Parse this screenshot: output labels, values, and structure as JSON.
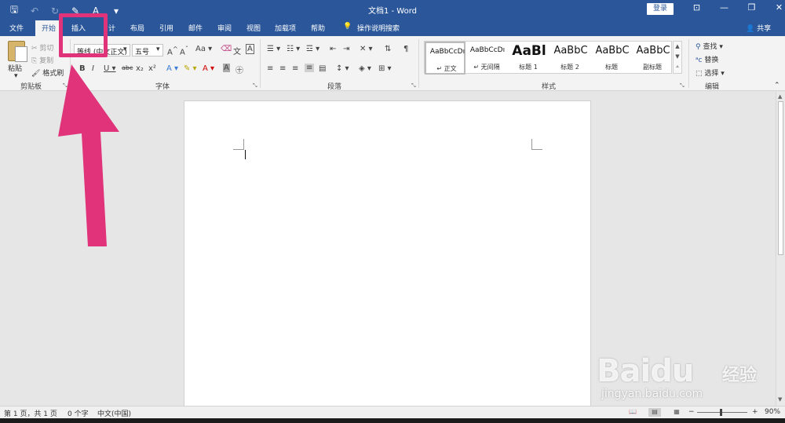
{
  "app": {
    "doc_title": "文档1 - Word",
    "login": "登录",
    "share": "共享"
  },
  "tabs": [
    "文件",
    "开始",
    "插入",
    "计",
    "布局",
    "引用",
    "邮件",
    "审阅",
    "视图",
    "加载项",
    "帮助"
  ],
  "tell_me": "操作说明搜索",
  "clipboard": {
    "paste": "粘贴",
    "cut": "剪切",
    "copy": "复制",
    "format_painter": "格式刷",
    "label": "剪贴板"
  },
  "font": {
    "family_value": "等线 (中文正文)",
    "size_value": "五号",
    "label": "字体"
  },
  "paragraph": {
    "label": "段落"
  },
  "styles": {
    "label": "样式",
    "items": [
      {
        "sample": "AaBbCcDı",
        "name": "↵ 正文"
      },
      {
        "sample": "AaBbCcDı",
        "name": "↵ 无间隔"
      },
      {
        "sample": "AaBl",
        "name": "标题 1"
      },
      {
        "sample": "AaBbC",
        "name": "标题 2"
      },
      {
        "sample": "AaBbC",
        "name": "标题"
      },
      {
        "sample": "AaBbC",
        "name": "副标题"
      }
    ]
  },
  "editing": {
    "find": "查找",
    "replace": "替换",
    "select": "选择",
    "label": "编辑"
  },
  "status": {
    "pages": "第 1 页，共 1 页",
    "words": "0 个字",
    "language": "中文(中国)",
    "zoom": "90%"
  },
  "watermark": {
    "logo": "Baidu",
    "sub": "经验",
    "url": "jingyan.baidu.com"
  },
  "colors": {
    "title_blue": "#2b579a",
    "annotation_pink": "#e0337a"
  }
}
